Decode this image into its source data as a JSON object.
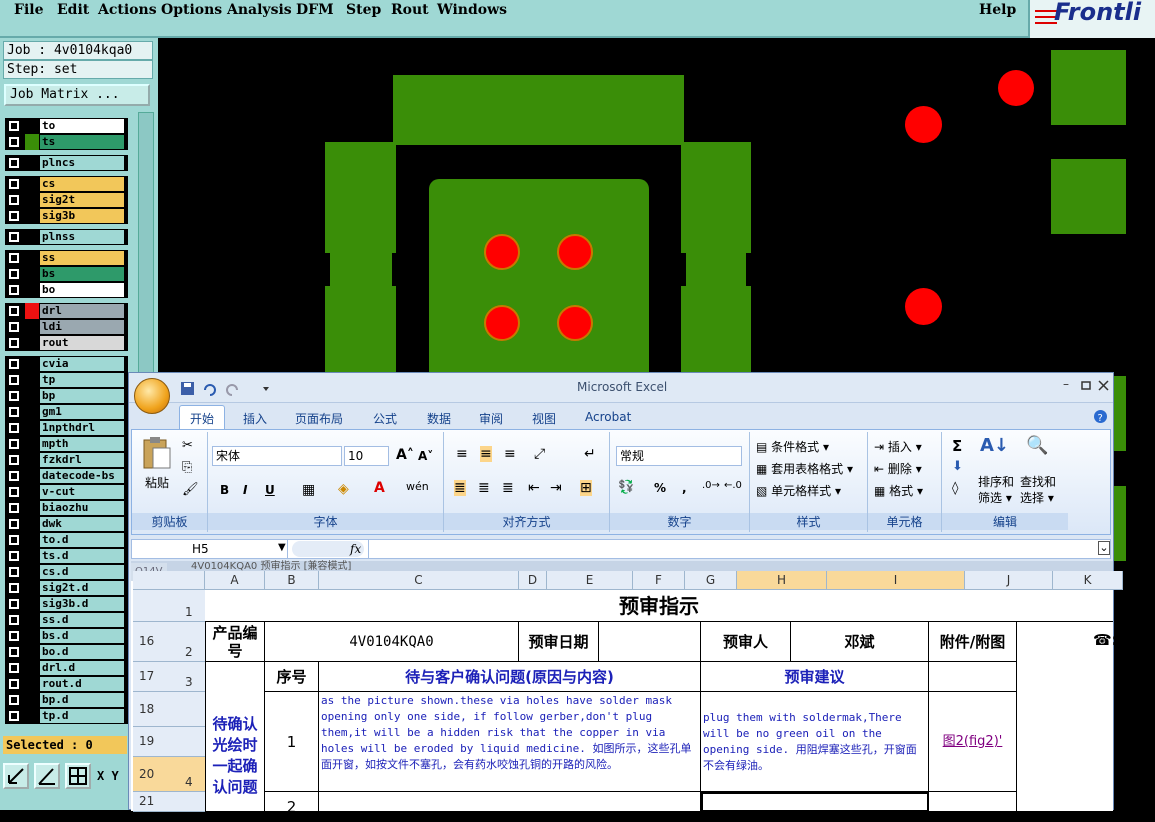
{
  "menu": [
    "File",
    "Edit",
    "Actions",
    "Options",
    "Analysis",
    "DFM",
    "Step",
    "Rout",
    "Windows"
  ],
  "help": "Help",
  "logo": "Frontli",
  "job": {
    "job_line": "Job : 4v0104kqa0",
    "step_line": "Step: set",
    "matrix_button": "Job Matrix ..."
  },
  "layers": [
    {
      "name": "to",
      "color": "#ffffff",
      "swatch": "#000000"
    },
    {
      "name": "ts",
      "color": "#2e9a6a",
      "swatch": "#3a8e08"
    },
    {
      "name": "plncs",
      "color": "#9fd8d4",
      "swatch": "#000000"
    },
    {
      "name": "cs",
      "color": "#f2c75a",
      "swatch": "#000000"
    },
    {
      "name": "sig2t",
      "color": "#f2c75a",
      "swatch": "#000000"
    },
    {
      "name": "sig3b",
      "color": "#f2c75a",
      "swatch": "#000000"
    },
    {
      "name": "plnss",
      "color": "#9fd8d4",
      "swatch": "#000000"
    },
    {
      "name": "ss",
      "color": "#f2c75a",
      "swatch": "#000000"
    },
    {
      "name": "bs",
      "color": "#2e9a6a",
      "swatch": "#000000"
    },
    {
      "name": "bo",
      "color": "#ffffff",
      "swatch": "#000000"
    },
    {
      "name": "drl",
      "color": "#9aa8b0",
      "swatch": "#ee1111"
    },
    {
      "name": "ldi",
      "color": "#9aa8b0",
      "swatch": "#000000"
    },
    {
      "name": "rout",
      "color": "#d8d8d8",
      "swatch": "#000000"
    },
    {
      "name": "cvia",
      "color": "#9fd8d4",
      "swatch": "#000000"
    },
    {
      "name": "tp",
      "color": "#9fd8d4",
      "swatch": "#000000"
    },
    {
      "name": "bp",
      "color": "#9fd8d4",
      "swatch": "#000000"
    },
    {
      "name": "gm1",
      "color": "#9fd8d4",
      "swatch": "#000000"
    },
    {
      "name": "1npthdrl",
      "color": "#9fd8d4",
      "swatch": "#000000"
    },
    {
      "name": "mpth",
      "color": "#9fd8d4",
      "swatch": "#000000"
    },
    {
      "name": "fzkdrl",
      "color": "#9fd8d4",
      "swatch": "#000000"
    },
    {
      "name": "datecode-bs",
      "color": "#9fd8d4",
      "swatch": "#000000"
    },
    {
      "name": "v-cut",
      "color": "#9fd8d4",
      "swatch": "#000000"
    },
    {
      "name": "biaozhu",
      "color": "#9fd8d4",
      "swatch": "#000000"
    },
    {
      "name": "dwk",
      "color": "#9fd8d4",
      "swatch": "#000000"
    },
    {
      "name": "to.d",
      "color": "#9fd8d4",
      "swatch": "#000000"
    },
    {
      "name": "ts.d",
      "color": "#9fd8d4",
      "swatch": "#000000"
    },
    {
      "name": "cs.d",
      "color": "#9fd8d4",
      "swatch": "#000000"
    },
    {
      "name": "sig2t.d",
      "color": "#9fd8d4",
      "swatch": "#000000"
    },
    {
      "name": "sig3b.d",
      "color": "#9fd8d4",
      "swatch": "#000000"
    },
    {
      "name": "ss.d",
      "color": "#9fd8d4",
      "swatch": "#000000"
    },
    {
      "name": "bs.d",
      "color": "#9fd8d4",
      "swatch": "#000000"
    },
    {
      "name": "bo.d",
      "color": "#9fd8d4",
      "swatch": "#000000"
    },
    {
      "name": "drl.d",
      "color": "#9fd8d4",
      "swatch": "#000000"
    },
    {
      "name": "rout.d",
      "color": "#9fd8d4",
      "swatch": "#000000"
    },
    {
      "name": "bp.d",
      "color": "#9fd8d4",
      "swatch": "#000000"
    },
    {
      "name": "tp.d",
      "color": "#9fd8d4",
      "swatch": "#000000"
    }
  ],
  "selected": "Selected : 0",
  "xy_label": "X Y",
  "excel": {
    "title": "Microsoft Excel",
    "tabs": [
      "开始",
      "插入",
      "页面布局",
      "公式",
      "数据",
      "审阅",
      "视图",
      "Acrobat"
    ],
    "paste": "粘贴",
    "font_name": "宋体",
    "font_size": "10",
    "number_format": "常规",
    "percent": "%",
    "comma": ",",
    "styles": [
      "条件格式 ▾",
      "套用表格格式 ▾",
      "单元格样式 ▾"
    ],
    "cells_btns": [
      "插入 ▾",
      "删除 ▾",
      "格式 ▾"
    ],
    "sort_filter": "排序和筛选 ▾",
    "find_select": "查找和选择 ▾",
    "group_labels": [
      "剪贴板",
      "字体",
      "对齐方式",
      "数字",
      "样式",
      "单元格",
      "编辑"
    ],
    "name_box": "H5",
    "fx": "fx",
    "window_title": "4V0104KQA0 预审指示 [兼容模式]",
    "prev_tab": "Q14V",
    "col_headers": [
      "A",
      "B",
      "C",
      "D",
      "E",
      "F",
      "G",
      "H",
      "I",
      "J",
      "K"
    ],
    "row_headers": [
      {
        "outer": "",
        "inner": "1"
      },
      {
        "outer": "16",
        "inner": "2"
      },
      {
        "outer": "17",
        "inner": "3"
      },
      {
        "outer": "18",
        "inner": ""
      },
      {
        "outer": "19",
        "inner": ""
      },
      {
        "outer": "20",
        "inner": "4"
      },
      {
        "outer": "21",
        "inner": ""
      }
    ],
    "sheet_title": "预审指示",
    "product_label": "产品编号",
    "product_value": "4V0104KQA0",
    "date_label": "预审日期",
    "reviewer_label": "预审人",
    "reviewer_value": "邓斌",
    "attach_label": "附件/附图",
    "row3_no": "序号",
    "row3_issue": "待与客户确认问题(原因与内容)",
    "row3_advice": "预审建议",
    "side_label": "待确认光绘时一起确认问题",
    "item1_no": "1",
    "item1_issue": "as the picture shown.these via holes have solder mask opening only one side, if follow gerber,don't plug them,it will be a hidden risk that the copper in via holes will be eroded by liquid medicine. 如图所示，这些孔单面开窗，如按文件不塞孔，会有药水咬蚀孔铜的开路的风险。",
    "item1_advice": "plug them  with soldermak,There will be no green oil on the opening side. 用阻焊塞这些孔，开窗面不会有绿油。",
    "item1_attach": "图2(fig2)'",
    "item2_no": "2",
    "phone_glyph": "☎:"
  }
}
